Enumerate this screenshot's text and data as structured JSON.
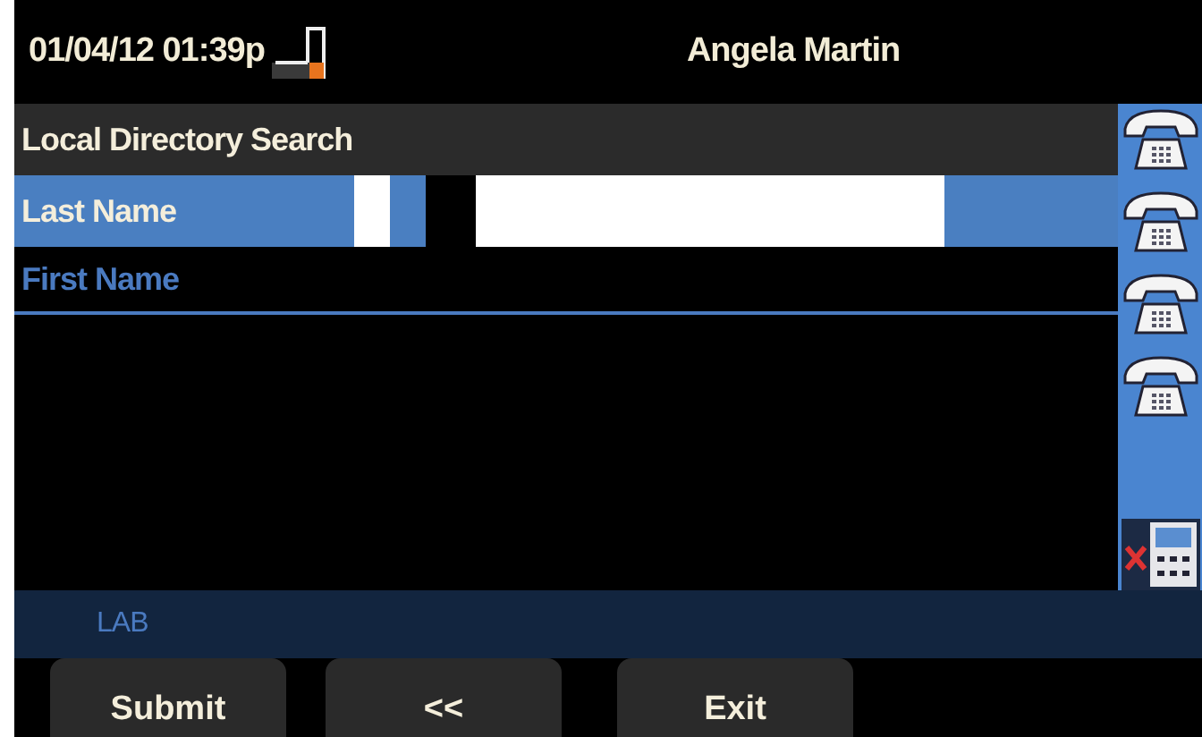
{
  "header": {
    "datetime": "01/04/12 01:39p",
    "user": "Angela Martin"
  },
  "title": "Local Directory Search",
  "fields": [
    {
      "label": "Last Name",
      "selected": true,
      "has_input": true
    },
    {
      "label": "First Name",
      "selected": false,
      "has_input": false
    }
  ],
  "line_keys": [
    {
      "kind": "phone"
    },
    {
      "kind": "phone"
    },
    {
      "kind": "phone"
    },
    {
      "kind": "phone"
    },
    {
      "kind": "phone-off"
    }
  ],
  "status_label": "LAB",
  "softkeys": [
    "Submit",
    "<<",
    "Exit"
  ]
}
